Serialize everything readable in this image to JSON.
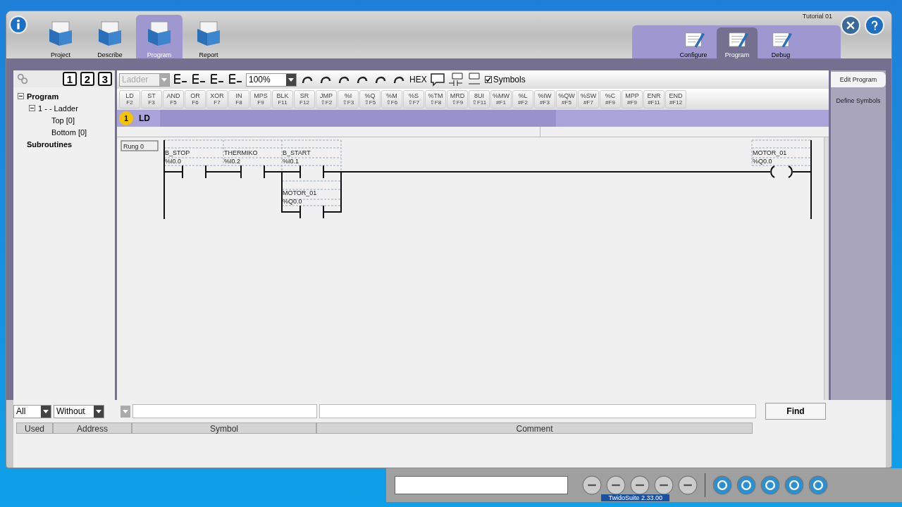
{
  "window": {
    "title": "Tutorial 01"
  },
  "main_tabs": [
    {
      "label": "Project",
      "selected": false
    },
    {
      "label": "Describe",
      "selected": false
    },
    {
      "label": "Program",
      "selected": true
    },
    {
      "label": "Report",
      "selected": false
    }
  ],
  "sub_tabs": [
    {
      "label": "Configure",
      "selected": false
    },
    {
      "label": "Program",
      "selected": true
    },
    {
      "label": "Debug",
      "selected": false
    }
  ],
  "side_tabs": [
    {
      "label": "Edit Program",
      "selected": true
    },
    {
      "label": "Define Symbols",
      "selected": false
    }
  ],
  "view_buttons": [
    "1",
    "2",
    "3"
  ],
  "tree": [
    {
      "label": "Program",
      "bold": true,
      "expanded": true,
      "children": [
        {
          "label": "1 -  - Ladder",
          "bold": false,
          "expanded": true,
          "children": [
            {
              "label": "Top [0]",
              "bold": false
            },
            {
              "label": "Bottom [0]",
              "bold": false
            }
          ]
        }
      ]
    },
    {
      "label": "Subroutines",
      "bold": true
    }
  ],
  "toolbar": {
    "language": "Ladder",
    "zoom": "100%",
    "hex": "HEX",
    "symbols": {
      "label": "Symbols",
      "checked": true
    }
  },
  "instructions": [
    {
      "label": "LD",
      "key": "F2"
    },
    {
      "label": "ST",
      "key": "F3"
    },
    {
      "label": "AND",
      "key": "F5"
    },
    {
      "label": "OR",
      "key": "F6"
    },
    {
      "label": "XOR",
      "key": "F7"
    },
    {
      "label": "IN",
      "key": "F8"
    },
    {
      "label": "MPS",
      "key": "F9"
    },
    {
      "label": "BLK",
      "key": "F11"
    },
    {
      "label": "SR",
      "key": "F12"
    },
    {
      "label": "JMP",
      "key": "⇧F2"
    },
    {
      "label": "%I",
      "key": "⇧F3"
    },
    {
      "label": "%Q",
      "key": "⇧F5"
    },
    {
      "label": "%M",
      "key": "⇧F6"
    },
    {
      "label": "%S",
      "key": "⇧F7"
    },
    {
      "label": "%TM",
      "key": "⇧F8"
    },
    {
      "label": "MRD",
      "key": "⇧F9"
    },
    {
      "label": "8UI",
      "key": "⇧F11"
    },
    {
      "label": "%MW",
      "key": "#F1"
    },
    {
      "label": "%L",
      "key": "#F2"
    },
    {
      "label": "%IW",
      "key": "#F3"
    },
    {
      "label": "%QW",
      "key": "#F5"
    },
    {
      "label": "%SW",
      "key": "#F7"
    },
    {
      "label": "%C",
      "key": "#F9"
    },
    {
      "label": "MPP",
      "key": "#F9"
    },
    {
      "label": "ENR",
      "key": "#F11"
    },
    {
      "label": "END",
      "key": "#F12"
    }
  ],
  "section": {
    "number": "1",
    "label": "LD"
  },
  "rung": {
    "label": "Rung 0",
    "contacts": [
      {
        "symbol": "B_STOP",
        "address": "%I0.0"
      },
      {
        "symbol": "THERMIKO",
        "address": "%I0.2"
      },
      {
        "symbol": "B_START",
        "address": "%I0.1"
      }
    ],
    "branch_contact": {
      "symbol": "MOTOR_01",
      "address": "%Q0.0"
    },
    "coil": {
      "symbol": "MOTOR_01",
      "address": "%Q0.0"
    }
  },
  "symbol_filter": {
    "scope": "All",
    "comment_filter": "Without",
    "find": "Find",
    "columns": [
      "Used",
      "Address",
      "Symbol",
      "Comment"
    ]
  },
  "status": {
    "version": "TwidoSuite 2.33.00"
  }
}
